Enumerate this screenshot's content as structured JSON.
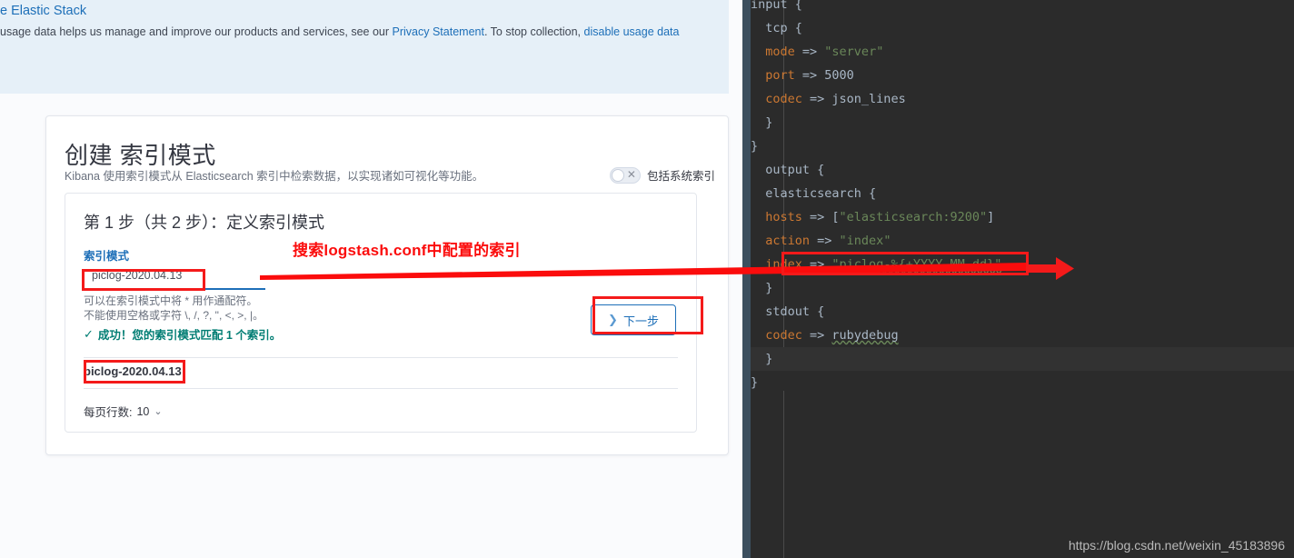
{
  "telemetry": {
    "title": "e Elastic Stack",
    "body_pre": "usage data helps us manage and improve our products and services, see our ",
    "link1": "Privacy Statement",
    "body_mid": ". To stop collection, ",
    "link2": "disable usage data"
  },
  "card": {
    "title": "创建 索引模式",
    "subtitle": "Kibana 使用索引模式从 Elasticsearch 索引中检索数据，以实现诸如可视化等功能。",
    "system_index_toggle_label": "包括系统索引",
    "system_index_toggle_state": "off",
    "toggle_x_glyph": "✕"
  },
  "step": {
    "title": "第 1 步（共 2 步）：定义索引模式",
    "field_label": "索引模式",
    "input_value": "piclog-2020.04.13",
    "helper_line1": "可以在索引模式中将 * 用作通配符。",
    "helper_line2": "不能使用空格或字符 \\, /, ?, \", <, >, |。",
    "success_check": "✓",
    "success_text": "成功！您的索引模式匹配 1 个索引。",
    "next_button_label": "下一步",
    "next_button_chevron": "❯"
  },
  "table": {
    "rows": [
      "piclog-2020.04.13"
    ],
    "rows_per_page_label": "每页行数:",
    "rows_per_page_value": "10",
    "rows_per_page_chevron": "⌄"
  },
  "code": {
    "lines": [
      "input {",
      "  tcp {",
      "  mode => \"server\"",
      "  port => 5000",
      "  codec => json_lines",
      "  }",
      "}",
      "  output {",
      "  elasticsearch {",
      "  hosts => [\"elasticsearch:9200\"]",
      "  action => \"index\"",
      "  index => \"piclog-%{+YYYY.MM.dd}\"",
      "  }",
      "  stdout {",
      "  codec => rubydebug",
      "  }",
      "}"
    ]
  },
  "annotation": {
    "note": "搜索logstash.conf中配置的索引",
    "color": "#fb0c0c"
  },
  "watermark": "https://blog.csdn.net/weixin_45183896",
  "colors": {
    "accent_blue": "#1d6fb8",
    "success_green": "#017d73",
    "annotation_red": "#f41a1a",
    "editor_bg": "#2b2b2b",
    "gutter": "#3c4f5e"
  }
}
